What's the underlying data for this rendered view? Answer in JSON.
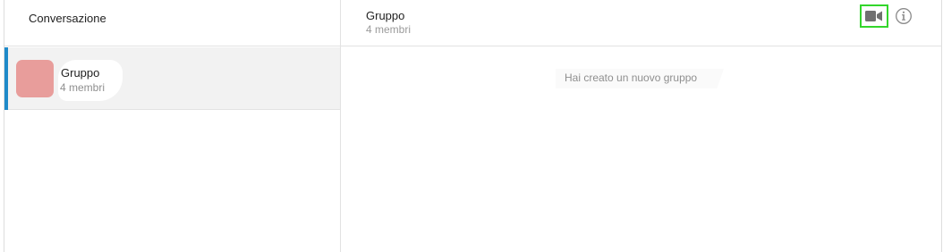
{
  "left_panel": {
    "title": "Conversazione",
    "conversations": [
      {
        "name": "Gruppo",
        "subtitle": "4 membri",
        "avatar_color": "#e89d9b",
        "active": true
      }
    ]
  },
  "chat": {
    "title": "Gruppo",
    "subtitle": "4 membri",
    "actions": [
      {
        "icon": "video-camera-icon",
        "highlight_color": "#33d62b"
      },
      {
        "icon": "info-icon"
      }
    ],
    "system_message": "Hai creato un nuovo gruppo"
  },
  "colors": {
    "accent": "#1f8ac9",
    "border": "#e2e2e2",
    "active_row_bg": "#f2f2f2"
  }
}
